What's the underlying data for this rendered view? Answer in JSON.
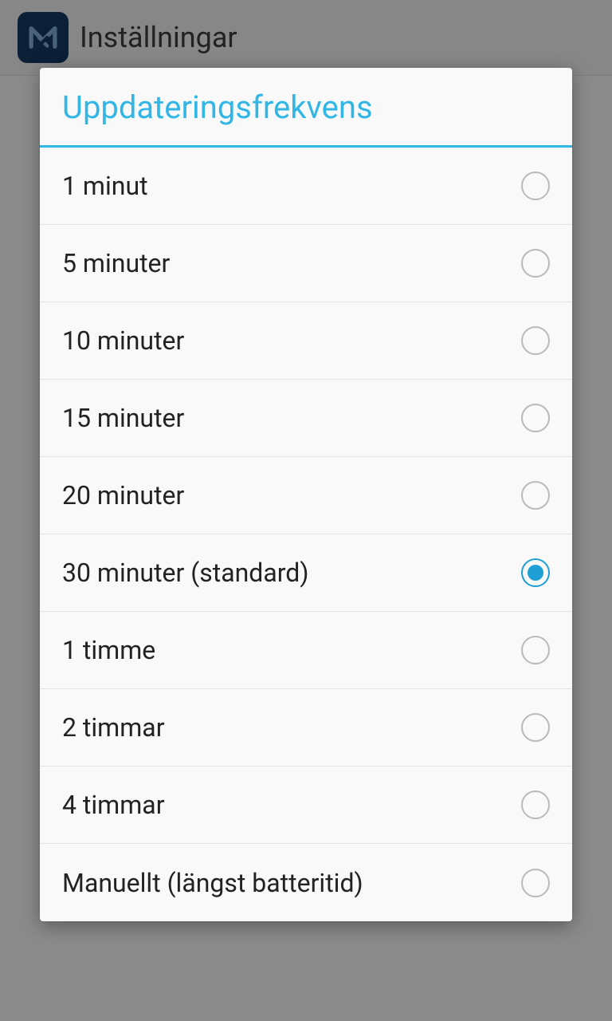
{
  "header": {
    "title": "Inställningar"
  },
  "dialog": {
    "title": "Uppdateringsfrekvens",
    "options": [
      {
        "label": "1 minut",
        "selected": false
      },
      {
        "label": "5 minuter",
        "selected": false
      },
      {
        "label": "10 minuter",
        "selected": false
      },
      {
        "label": "15 minuter",
        "selected": false
      },
      {
        "label": "20 minuter",
        "selected": false
      },
      {
        "label": "30 minuter (standard)",
        "selected": true
      },
      {
        "label": "1 timme",
        "selected": false
      },
      {
        "label": "2 timmar",
        "selected": false
      },
      {
        "label": "4 timmar",
        "selected": false
      },
      {
        "label": "Manuellt (längst batteritid)",
        "selected": false
      }
    ]
  }
}
